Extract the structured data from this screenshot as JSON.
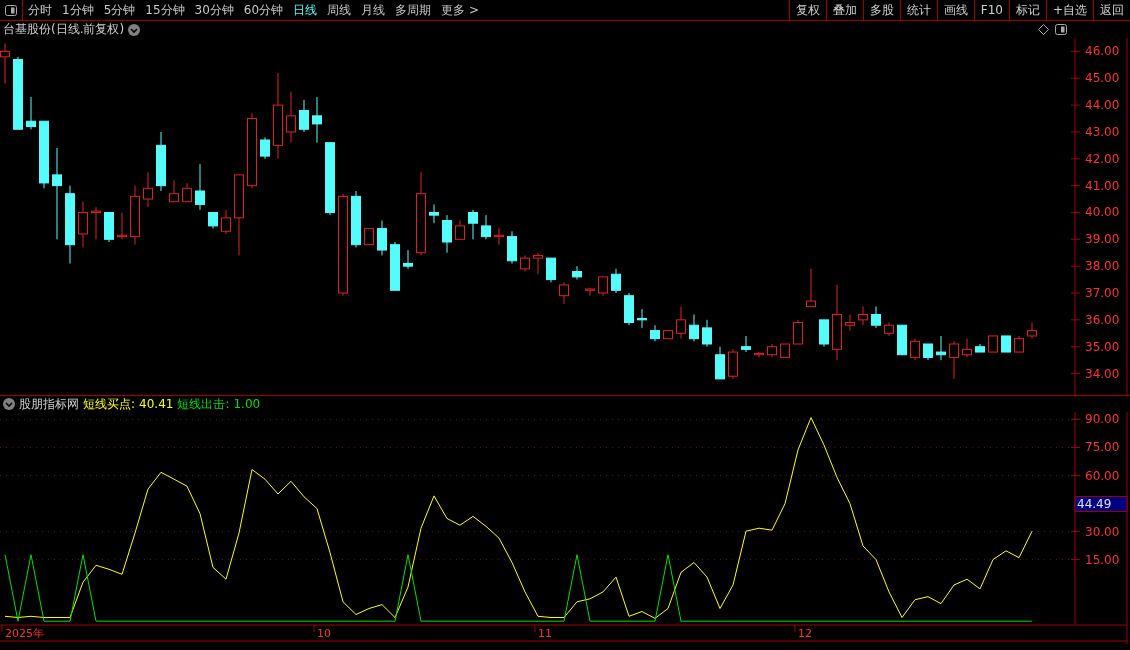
{
  "toolbar": {
    "tabs": [
      {
        "label": "分时",
        "selected": false
      },
      {
        "label": "1分钟",
        "selected": false
      },
      {
        "label": "5分钟",
        "selected": false
      },
      {
        "label": "15分钟",
        "selected": false
      },
      {
        "label": "30分钟",
        "selected": false
      },
      {
        "label": "60分钟",
        "selected": false
      },
      {
        "label": "日线",
        "selected": true
      },
      {
        "label": "周线",
        "selected": false
      },
      {
        "label": "月线",
        "selected": false
      },
      {
        "label": "多周期",
        "selected": false
      },
      {
        "label": "更多 >",
        "selected": false
      }
    ],
    "buttons": [
      "复权",
      "叠加",
      "多股",
      "统计",
      "画线",
      "F10",
      "标记",
      "+自选",
      "返回"
    ]
  },
  "title": "台基股份(日线.前复权)",
  "price_chart": {
    "chart_data": {
      "type": "candlestick",
      "ylim": [
        33.2,
        46.5
      ],
      "yticks": [
        {
          "value": 46,
          "label": "46.00"
        },
        {
          "value": 45,
          "label": "45.00"
        },
        {
          "value": 44,
          "label": "44.00"
        },
        {
          "value": 43,
          "label": "43.00"
        },
        {
          "value": 42,
          "label": "42.00"
        },
        {
          "value": 41,
          "label": "41.00"
        },
        {
          "value": 40,
          "label": "40.00"
        },
        {
          "value": 39,
          "label": "39.00"
        },
        {
          "value": 38,
          "label": "38.00"
        },
        {
          "value": 37,
          "label": "37.00"
        },
        {
          "value": 36,
          "label": "36.00"
        },
        {
          "value": 35,
          "label": "35.00"
        },
        {
          "value": 34,
          "label": "34.00"
        }
      ],
      "ohlc": [
        [
          45.8,
          46.3,
          44.8,
          46.0
        ],
        [
          45.7,
          45.8,
          43.1,
          43.1
        ],
        [
          43.4,
          44.3,
          43.1,
          43.2
        ],
        [
          43.4,
          43.4,
          40.9,
          41.1
        ],
        [
          41.4,
          42.4,
          39.0,
          41.0
        ],
        [
          40.7,
          41.0,
          38.1,
          38.8
        ],
        [
          39.2,
          40.4,
          38.7,
          40.0
        ],
        [
          40.0,
          40.2,
          39.0,
          40.05
        ],
        [
          40.0,
          40.0,
          38.9,
          39.0
        ],
        [
          39.1,
          40.0,
          39.0,
          39.15
        ],
        [
          39.1,
          41.0,
          38.8,
          40.6
        ],
        [
          40.5,
          41.5,
          40.2,
          40.9
        ],
        [
          42.5,
          43.0,
          40.8,
          41.0
        ],
        [
          40.4,
          41.2,
          40.4,
          40.7
        ],
        [
          40.4,
          41.1,
          40.4,
          40.9
        ],
        [
          40.8,
          41.8,
          40.1,
          40.3
        ],
        [
          40.0,
          40.0,
          39.4,
          39.5
        ],
        [
          39.3,
          40.1,
          39.2,
          39.8
        ],
        [
          39.8,
          41.4,
          38.4,
          41.4
        ],
        [
          41.0,
          43.7,
          40.9,
          43.5
        ],
        [
          42.7,
          42.8,
          42.0,
          42.1
        ],
        [
          42.5,
          45.2,
          42.0,
          44.0
        ],
        [
          43.0,
          44.5,
          42.6,
          43.6
        ],
        [
          43.8,
          44.2,
          43.0,
          43.1
        ],
        [
          43.6,
          44.3,
          42.6,
          43.3
        ],
        [
          42.6,
          42.6,
          39.9,
          40.0
        ],
        [
          37.0,
          40.7,
          36.9,
          40.6
        ],
        [
          40.6,
          40.8,
          38.7,
          38.8
        ],
        [
          38.8,
          39.4,
          38.8,
          39.4
        ],
        [
          39.4,
          39.7,
          38.4,
          38.6
        ],
        [
          38.8,
          38.9,
          37.1,
          37.1
        ],
        [
          38.1,
          38.6,
          37.9,
          38.0
        ],
        [
          38.5,
          41.5,
          38.4,
          40.7
        ],
        [
          40.0,
          40.3,
          39.6,
          39.9
        ],
        [
          39.7,
          39.9,
          38.5,
          38.9
        ],
        [
          39.0,
          39.7,
          39.0,
          39.5
        ],
        [
          40.0,
          40.1,
          39.0,
          39.6
        ],
        [
          39.5,
          39.9,
          39.0,
          39.1
        ],
        [
          39.1,
          39.4,
          38.8,
          39.15
        ],
        [
          39.1,
          39.3,
          38.1,
          38.2
        ],
        [
          37.9,
          38.4,
          37.8,
          38.3
        ],
        [
          38.3,
          38.5,
          37.7,
          38.4
        ],
        [
          38.3,
          38.3,
          37.4,
          37.5
        ],
        [
          36.9,
          37.4,
          36.6,
          37.3
        ],
        [
          37.8,
          38.0,
          37.5,
          37.6
        ],
        [
          37.1,
          37.2,
          36.9,
          37.15
        ],
        [
          37.0,
          37.6,
          36.9,
          37.6
        ],
        [
          37.7,
          37.9,
          37.0,
          37.1
        ],
        [
          36.9,
          37.0,
          35.8,
          35.9
        ],
        [
          36.05,
          36.4,
          35.7,
          36.0
        ],
        [
          35.6,
          35.8,
          35.2,
          35.3
        ],
        [
          35.3,
          35.6,
          35.3,
          35.6
        ],
        [
          35.5,
          36.5,
          35.3,
          36.0
        ],
        [
          35.8,
          36.2,
          35.2,
          35.3
        ],
        [
          35.7,
          36.0,
          35.0,
          35.1
        ],
        [
          34.7,
          35.0,
          33.8,
          33.8
        ],
        [
          33.9,
          34.9,
          33.8,
          34.8
        ],
        [
          35.0,
          35.4,
          34.8,
          34.9
        ],
        [
          34.7,
          34.8,
          34.6,
          34.75
        ],
        [
          34.7,
          35.1,
          34.6,
          35.0
        ],
        [
          34.6,
          35.1,
          34.6,
          35.1
        ],
        [
          35.1,
          36.0,
          35.1,
          35.9
        ],
        [
          36.5,
          37.9,
          36.5,
          36.7
        ],
        [
          36.0,
          36.0,
          35.0,
          35.1
        ],
        [
          34.9,
          37.3,
          34.5,
          36.2
        ],
        [
          35.8,
          36.2,
          35.6,
          35.9
        ],
        [
          36.0,
          36.5,
          35.8,
          36.2
        ],
        [
          36.2,
          36.5,
          35.7,
          35.8
        ],
        [
          35.5,
          35.9,
          35.4,
          35.8
        ],
        [
          35.8,
          35.8,
          34.7,
          34.7
        ],
        [
          34.6,
          35.3,
          34.5,
          35.2
        ],
        [
          35.1,
          35.1,
          34.5,
          34.6
        ],
        [
          34.8,
          35.4,
          34.5,
          34.7
        ],
        [
          34.6,
          35.2,
          33.8,
          35.1
        ],
        [
          34.7,
          35.3,
          34.6,
          34.9
        ],
        [
          35.0,
          35.1,
          34.8,
          34.8
        ],
        [
          34.8,
          35.4,
          34.8,
          35.4
        ],
        [
          35.4,
          35.4,
          34.8,
          34.8
        ],
        [
          34.8,
          35.4,
          34.8,
          35.3
        ],
        [
          35.4,
          35.9,
          35.3,
          35.6
        ]
      ]
    }
  },
  "indicator": {
    "name": "股朋指标网",
    "readout_values": [
      "40.41",
      "1.00"
    ],
    "value_marker": "44.49",
    "date_labels": [
      "2025年",
      "10",
      "11",
      "12"
    ],
    "chart_data": {
      "type": "line",
      "ylim": [
        -19.5,
        94
      ],
      "grid": true,
      "yticks": [
        {
          "value": 90,
          "label": "90.00"
        },
        {
          "value": 75,
          "label": "75.00"
        },
        {
          "value": 60,
          "label": "60.00"
        },
        {
          "value": 30,
          "label": "30.00"
        },
        {
          "value": 15,
          "label": "15.00"
        }
      ],
      "series": [
        {
          "name": "短线买点:",
          "color": "#ffff00",
          "values": [
            -15.4,
            -16,
            -15.4,
            -16,
            -16,
            -16,
            2.9,
            11.9,
            9.8,
            7.1,
            29.2,
            52.7,
            61.7,
            58.0,
            54.3,
            39.6,
            10.8,
            4.5,
            29.2,
            63.2,
            58.0,
            50.1,
            56.9,
            48.6,
            42.3,
            18.7,
            -7.6,
            -14.4,
            -11.2,
            -9.1,
            -16,
            0.3,
            31.8,
            49.1,
            37.0,
            33.4,
            38.1,
            32.8,
            26.5,
            13.4,
            -2.3,
            -15.4,
            -16,
            -16,
            -7.6,
            -6.0,
            -2.3,
            5.6,
            -15.4,
            -12.8,
            -16.5,
            -11.2,
            8.2,
            13.4,
            5.6,
            -11.2,
            1.4,
            30.2,
            31.8,
            30.7,
            44.9,
            73.7,
            91.0,
            76.3,
            59.0,
            44.9,
            22.3,
            15.0,
            -2.3,
            -16,
            -6.5,
            -4.9,
            -8.6,
            1.4,
            4.5,
            -0.7,
            15.0,
            19.7,
            16.0,
            30.2
          ]
        },
        {
          "name": "短线出击:",
          "color": "#00e000",
          "values": [
            17.6,
            -18,
            17.6,
            -18,
            -18,
            -18,
            17.6,
            -18,
            -18,
            -18,
            -18,
            -18,
            -18,
            -18,
            -18,
            -18,
            -18,
            -18,
            -18,
            -18,
            -18,
            -18,
            -18,
            -18,
            -18,
            -18,
            -18,
            -18,
            -18,
            -18,
            -18,
            17.6,
            -18,
            -18,
            -18,
            -18,
            -18,
            -18,
            -18,
            -18,
            -18,
            -18,
            -18,
            -18,
            17.6,
            -18,
            -18,
            -18,
            -18,
            -18,
            -18,
            17.6,
            -18,
            -18,
            -18,
            -18,
            -18,
            -18,
            -18,
            -18,
            -18,
            -18,
            -18,
            -18,
            -18,
            -18,
            -18,
            -18,
            -18,
            -18,
            -18,
            -18,
            -18,
            -18,
            -18,
            -18,
            -18,
            -18,
            -18,
            -18
          ]
        }
      ]
    }
  }
}
